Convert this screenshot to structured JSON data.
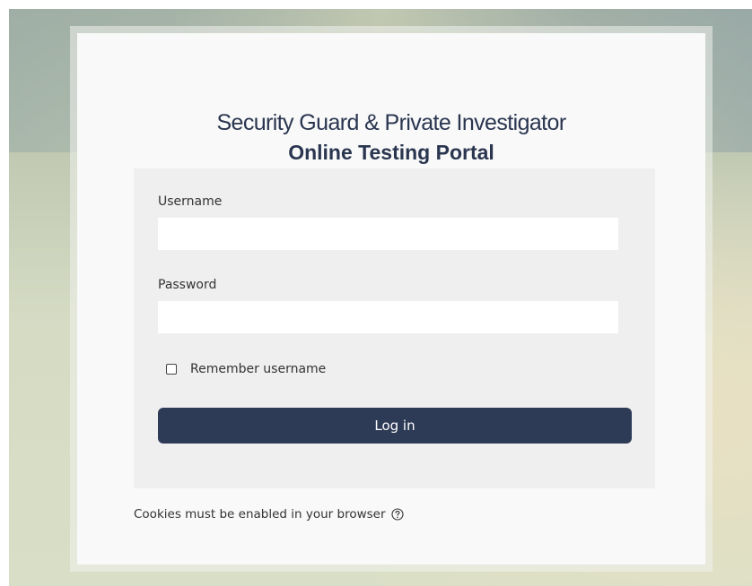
{
  "header": {
    "title_line1": "Security Guard & Private Investigator",
    "title_line2": "Online Testing Portal"
  },
  "form": {
    "username_label": "Username",
    "username_value": "",
    "password_label": "Password",
    "password_value": "",
    "remember_label": "Remember username",
    "remember_checked": false,
    "login_label": "Log in"
  },
  "footer": {
    "cookies_text": "Cookies must be enabled in your browser",
    "help_icon": "question-circle-icon"
  },
  "colors": {
    "brand_navy": "#2e3b56",
    "title_text": "#2a3550",
    "form_bg": "#efefef"
  }
}
